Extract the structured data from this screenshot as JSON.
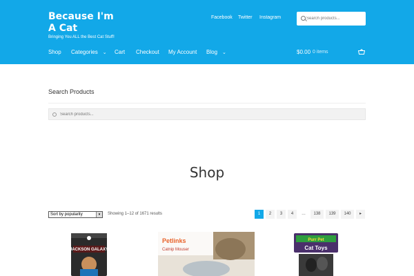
{
  "site": {
    "title": "Because I'm A Cat",
    "tagline": "Bringing You ALL the Best Cat Stuff!"
  },
  "social": [
    "Facebook",
    "Twitter",
    "Instagram"
  ],
  "header_search": {
    "placeholder": "Search products..."
  },
  "nav": {
    "items": [
      "Shop",
      "Categories",
      "Cart",
      "Checkout",
      "My Account",
      "Blog"
    ]
  },
  "cart": {
    "total": "$0.00",
    "items": "0 items"
  },
  "search_widget": {
    "title": "Search Products",
    "placeholder": "Search products..."
  },
  "shop": {
    "title": "Shop",
    "sort_selected": "Sort by popularity",
    "results_text": "Showing 1–12 of 1671 results",
    "pagination": [
      "1",
      "2",
      "3",
      "4",
      "…",
      "138",
      "139",
      "140"
    ],
    "current_page": "1"
  },
  "products": [
    {
      "brand_text": "JACKSON GALAXY"
    },
    {
      "brand_text": "Petlinks",
      "product_text": "Catnip Mouser"
    },
    {
      "brand_text": "Purr Pet",
      "product_text": "Cat Toys"
    }
  ],
  "colors": {
    "header": "#12a8e8",
    "active_page": "#12a8e8"
  }
}
